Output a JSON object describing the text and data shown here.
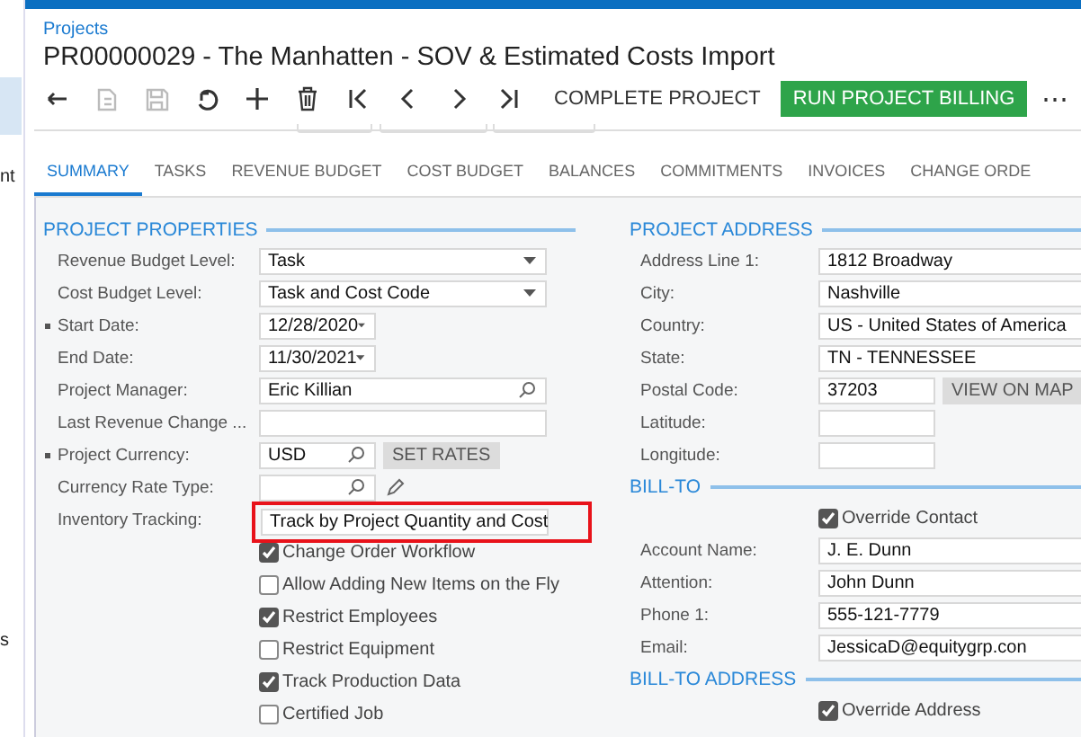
{
  "sidebar": {
    "items": [
      {
        "label": "nt"
      },
      {
        "label": "s"
      }
    ]
  },
  "header": {
    "breadcrumb": "Projects",
    "title": "PR00000029 - The Manhatten - SOV & Estimated Costs Import"
  },
  "toolbar": {
    "icons": [
      {
        "kind": "back",
        "disabled": false
      },
      {
        "kind": "copy",
        "disabled": true
      },
      {
        "kind": "save",
        "disabled": true
      },
      {
        "kind": "undo",
        "disabled": false
      },
      {
        "kind": "add",
        "disabled": false
      },
      {
        "kind": "delete",
        "disabled": false
      },
      {
        "kind": "first",
        "disabled": false
      },
      {
        "kind": "prev",
        "disabled": false
      },
      {
        "kind": "next",
        "disabled": false
      },
      {
        "kind": "last",
        "disabled": false
      }
    ],
    "actions": [
      {
        "label": "COMPLETE PROJECT",
        "primary": false
      },
      {
        "label": "RUN PROJECT BILLING",
        "primary": true
      }
    ],
    "more": "⋯"
  },
  "tabs": [
    {
      "label": "SUMMARY",
      "selected": true
    },
    {
      "label": "TASKS",
      "selected": false
    },
    {
      "label": "REVENUE BUDGET",
      "selected": false
    },
    {
      "label": "COST BUDGET",
      "selected": false
    },
    {
      "label": "BALANCES",
      "selected": false
    },
    {
      "label": "COMMITMENTS",
      "selected": false
    },
    {
      "label": "INVOICES",
      "selected": false
    },
    {
      "label": "CHANGE ORDE",
      "selected": false
    }
  ],
  "left_sections": [
    {
      "title": "PROJECT PROPERTIES",
      "rows": [
        {
          "kind": "select",
          "label": "Revenue Budget Level:",
          "value": "Task",
          "required": false,
          "highlighted": false
        },
        {
          "kind": "select",
          "label": "Cost Budget Level:",
          "value": "Task and Cost Code",
          "required": false,
          "highlighted": false
        },
        {
          "kind": "date",
          "label": "Start Date:",
          "value": "12/28/2020",
          "required": true,
          "highlighted": false
        },
        {
          "kind": "date",
          "label": "End Date:",
          "value": "11/30/2021",
          "required": false,
          "highlighted": false
        },
        {
          "kind": "lookup",
          "label": "Project Manager:",
          "value": "Eric Killian",
          "required": false,
          "highlighted": false
        },
        {
          "kind": "text",
          "label": "Last Revenue Change ...",
          "required": false,
          "highlighted": false
        },
        {
          "kind": "lookup_short",
          "label": "Project Currency:",
          "value": "USD",
          "button": "SET RATES",
          "required": true,
          "highlighted": false
        },
        {
          "kind": "lookup_edit",
          "label": "Currency Rate Type:",
          "required": false,
          "highlighted": false
        },
        {
          "kind": "select",
          "label": "Inventory Tracking:",
          "value": "Track by Project Quantity and Cost",
          "required": false,
          "highlighted": true
        },
        {
          "kind": "checkbox",
          "label": "Change Order Workflow",
          "checked": true
        },
        {
          "kind": "checkbox",
          "label": "Allow Adding New Items on the Fly",
          "checked": false
        },
        {
          "kind": "checkbox",
          "label": "Restrict Employees",
          "checked": true
        },
        {
          "kind": "checkbox",
          "label": "Restrict Equipment",
          "checked": false
        },
        {
          "kind": "checkbox",
          "label": "Track Production Data",
          "checked": true
        },
        {
          "kind": "checkbox",
          "label": "Certified Job",
          "checked": false
        }
      ]
    }
  ],
  "right_sections": [
    {
      "title": "PROJECT ADDRESS",
      "rows": [
        {
          "kind": "text",
          "label": "Address Line 1:",
          "value": "1812 Broadway"
        },
        {
          "kind": "text",
          "label": "City:",
          "value": "Nashville"
        },
        {
          "kind": "text",
          "label": "Country:",
          "value": "US - United States of America"
        },
        {
          "kind": "text",
          "label": "State:",
          "value": "TN - TENNESSEE"
        },
        {
          "kind": "text_short",
          "label": "Postal Code:",
          "value": "37203",
          "button": "VIEW ON MAP"
        },
        {
          "kind": "text_short",
          "label": "Latitude:"
        },
        {
          "kind": "text_short",
          "label": "Longitude:"
        }
      ]
    },
    {
      "title": "BILL-TO",
      "rows": [
        {
          "kind": "checkbox",
          "label": "Override Contact",
          "checked": true
        },
        {
          "kind": "text",
          "label": "Account Name:",
          "value": "J. E. Dunn"
        },
        {
          "kind": "text",
          "label": "Attention:",
          "value": "John Dunn"
        },
        {
          "kind": "text",
          "label": "Phone 1:",
          "value": "555-121-7779"
        },
        {
          "kind": "text",
          "label": "Email:",
          "value": "JessicaD@equitygrp.con"
        }
      ]
    },
    {
      "title": "BILL-TO ADDRESS",
      "rows": [
        {
          "kind": "checkbox",
          "label": "Override Address",
          "checked": true
        }
      ]
    }
  ]
}
